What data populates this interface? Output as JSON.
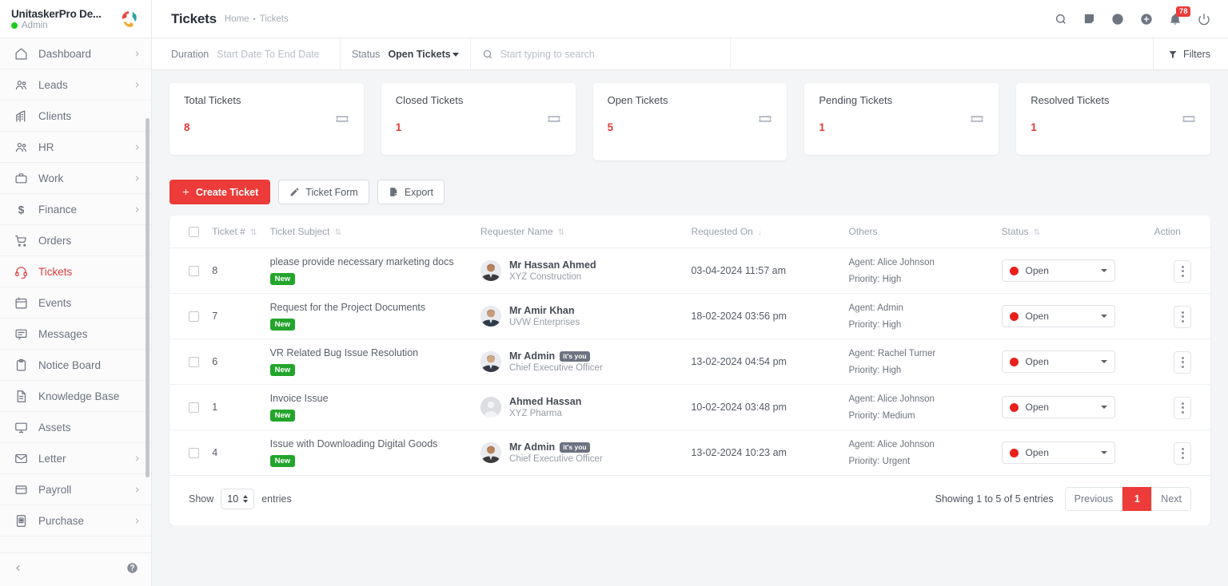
{
  "sidebar": {
    "brand_title": "UnitaskerPro De...",
    "brand_role": "Admin",
    "items": [
      {
        "label": "Dashboard",
        "icon": "home-icon",
        "expandable": true
      },
      {
        "label": "Leads",
        "icon": "users-icon",
        "expandable": true
      },
      {
        "label": "Clients",
        "icon": "building-icon",
        "expandable": false
      },
      {
        "label": "HR",
        "icon": "users-icon",
        "expandable": true
      },
      {
        "label": "Work",
        "icon": "briefcase-icon",
        "expandable": true
      },
      {
        "label": "Finance",
        "icon": "dollar-icon",
        "expandable": true
      },
      {
        "label": "Orders",
        "icon": "cart-icon",
        "expandable": false
      },
      {
        "label": "Tickets",
        "icon": "headset-icon",
        "expandable": false,
        "active": true
      },
      {
        "label": "Events",
        "icon": "calendar-icon",
        "expandable": false
      },
      {
        "label": "Messages",
        "icon": "chat-icon",
        "expandable": false
      },
      {
        "label": "Notice Board",
        "icon": "clipboard-icon",
        "expandable": false
      },
      {
        "label": "Knowledge Base",
        "icon": "document-icon",
        "expandable": false
      },
      {
        "label": "Assets",
        "icon": "monitor-icon",
        "expandable": false
      },
      {
        "label": "Letter",
        "icon": "envelope-icon",
        "expandable": true
      },
      {
        "label": "Payroll",
        "icon": "wallet-icon",
        "expandable": true
      },
      {
        "label": "Purchase",
        "icon": "purchase-icon",
        "expandable": true
      }
    ],
    "footer": {
      "collapse_icon": "chevron-left-icon",
      "help_icon": "help-circle-icon"
    }
  },
  "header": {
    "title": "Tickets",
    "breadcrumb_home": "Home",
    "breadcrumb_sep": "•",
    "breadcrumb_current": "Tickets",
    "icons": [
      {
        "name": "search-icon"
      },
      {
        "name": "note-icon"
      },
      {
        "name": "clock-icon"
      },
      {
        "name": "plus-circle-icon"
      },
      {
        "name": "bell-icon",
        "badge": "78"
      },
      {
        "name": "power-icon"
      }
    ],
    "notification_count": "78"
  },
  "filterbar": {
    "duration_label": "Duration",
    "duration_placeholder": "Start Date To End Date",
    "status_label": "Status",
    "status_value": "Open Tickets",
    "status_options": [
      "Open Tickets",
      "Closed Tickets",
      "Pending Tickets",
      "Resolved Tickets"
    ],
    "search_placeholder": "Start typing to search",
    "search_value": "",
    "filters_label": "Filters"
  },
  "stats": [
    {
      "title": "Total Tickets",
      "value": "8",
      "icon": "ticket-icon"
    },
    {
      "title": "Closed Tickets",
      "value": "1",
      "icon": "ticket-icon"
    },
    {
      "title": "Open Tickets",
      "value": "5",
      "icon": "ticket-icon"
    },
    {
      "title": "Pending Tickets",
      "value": "1",
      "icon": "ticket-icon"
    },
    {
      "title": "Resolved Tickets",
      "value": "1",
      "icon": "ticket-icon"
    }
  ],
  "actions": {
    "create_label": "Create Ticket",
    "form_label": "Ticket Form",
    "export_label": "Export"
  },
  "table": {
    "columns": [
      {
        "key": "check",
        "label": ""
      },
      {
        "key": "id",
        "label": "Ticket #",
        "sortable": true
      },
      {
        "key": "subj",
        "label": "Ticket Subject",
        "sortable": true
      },
      {
        "key": "req",
        "label": "Requester Name",
        "sortable": true
      },
      {
        "key": "on",
        "label": "Requested On",
        "sortable": true,
        "sorted": "desc"
      },
      {
        "key": "others",
        "label": "Others"
      },
      {
        "key": "status",
        "label": "Status",
        "sortable": true
      },
      {
        "key": "action",
        "label": "Action"
      }
    ],
    "rows": [
      {
        "id": "8",
        "subject": "please provide necessary marketing docs",
        "badge": "New",
        "requester_name": "Mr Hassan Ahmed",
        "requester_tag": "",
        "requester_org": "XYZ Construction",
        "avatar": "photo",
        "requested_on": "03-04-2024 11:57 am",
        "agent": "Agent: Alice Johnson",
        "priority": "Priority: High",
        "status": "Open",
        "status_color": "#e8201b"
      },
      {
        "id": "7",
        "subject": "Request for the Project Documents",
        "badge": "New",
        "requester_name": "Mr Amir Khan",
        "requester_tag": "",
        "requester_org": "UVW Enterprises",
        "avatar": "photo",
        "requested_on": "18-02-2024 03:56 pm",
        "agent": "Agent: Admin",
        "priority": "Priority: High",
        "status": "Open",
        "status_color": "#e8201b"
      },
      {
        "id": "6",
        "subject": "VR Related Bug Issue Resolution",
        "badge": "New",
        "requester_name": "Mr Admin",
        "requester_tag": "it's you",
        "requester_org": "Chief Executive Officer",
        "avatar": "photo",
        "requested_on": "13-02-2024 04:54 pm",
        "agent": "Agent: Rachel Turner",
        "priority": "Priority: High",
        "status": "Open",
        "status_color": "#e8201b"
      },
      {
        "id": "1",
        "subject": "Invoice Issue",
        "badge": "New",
        "requester_name": "Ahmed Hassan",
        "requester_tag": "",
        "requester_org": "XYZ Pharma",
        "avatar": "placeholder",
        "requested_on": "10-02-2024 03:48 pm",
        "agent": "Agent: Alice Johnson",
        "priority": "Priority: Medium",
        "status": "Open",
        "status_color": "#e8201b"
      },
      {
        "id": "4",
        "subject": "Issue with Downloading Digital Goods",
        "badge": "New",
        "requester_name": "Mr Admin",
        "requester_tag": "it's you",
        "requester_org": "Chief Executive Officer",
        "avatar": "photo",
        "requested_on": "13-02-2024 10:23 am",
        "agent": "Agent: Alice Johnson",
        "priority": "Priority: Urgent",
        "status": "Open",
        "status_color": "#e8201b"
      }
    ]
  },
  "footer": {
    "show_label": "Show",
    "entries_value": "10",
    "entries_label": "entries",
    "showing_text": "Showing 1 to 5 of 5 entries",
    "previous_label": "Previous",
    "page_label": "1",
    "next_label": "Next"
  }
}
